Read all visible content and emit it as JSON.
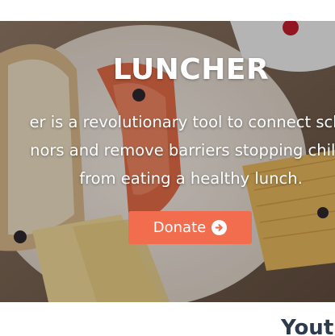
{
  "hero": {
    "title": "LUNCHER",
    "text_lines": [
      "er is a revolutionary tool to connect scho",
      "nors and remove barriers stopping childr",
      "from eating a healthy lunch."
    ],
    "donate_label": "Donate",
    "donate_icon": "arrow-circle-right-icon"
  },
  "section": {
    "heading": "Yout"
  },
  "colors": {
    "button": "#f26d4e",
    "heading": "#2d3b4d"
  }
}
